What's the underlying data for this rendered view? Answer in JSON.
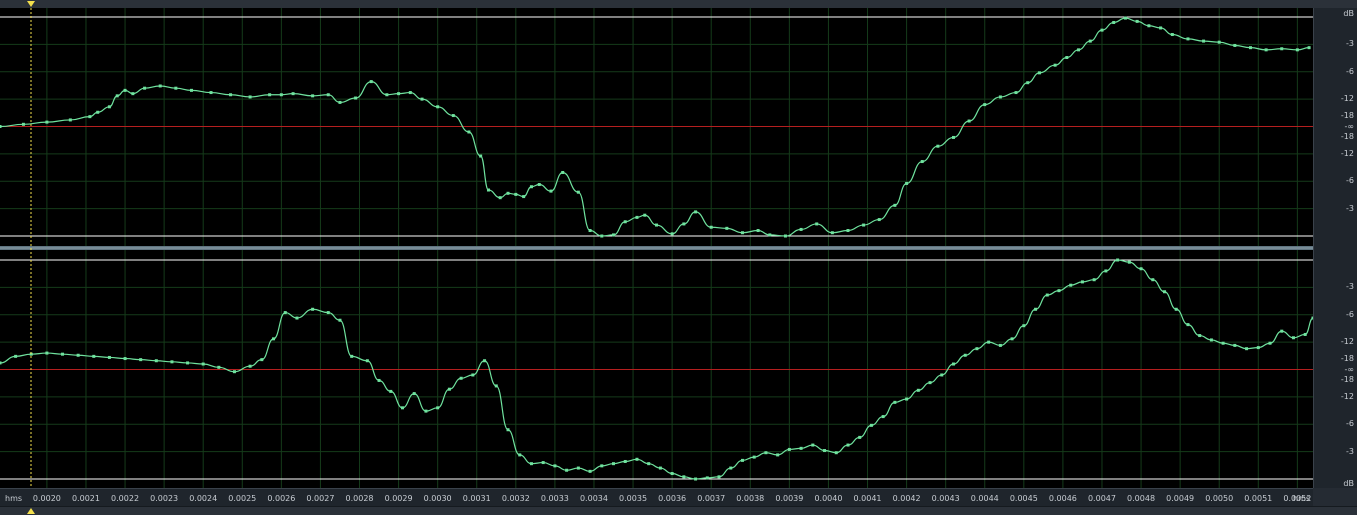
{
  "scale": {
    "unit_label": "dB",
    "channel1_labels": [
      "-3",
      "-6",
      "-12",
      "-18",
      "-∞",
      "-18",
      "-12",
      "-6",
      "-3"
    ],
    "channel2_labels": [
      "-3",
      "-6",
      "-12",
      "-18",
      "-∞",
      "-18",
      "-12",
      "-6",
      "-3"
    ]
  },
  "ruler": {
    "unit": "hms",
    "ticks": [
      "0.0020",
      "0.0021",
      "0.0022",
      "0.0023",
      "0.0024",
      "0.0025",
      "0.0026",
      "0.0027",
      "0.0028",
      "0.0029",
      "0.0030",
      "0.0031",
      "0.0032",
      "0.0033",
      "0.0034",
      "0.0035",
      "0.0036",
      "0.0037",
      "0.0038",
      "0.0039",
      "0.0040",
      "0.0041",
      "0.0042",
      "0.0043",
      "0.0044",
      "0.0045",
      "0.0046",
      "0.0047",
      "0.0048",
      "0.0049",
      "0.0050",
      "0.0051",
      "0.0052"
    ]
  },
  "colors": {
    "background": "#000000",
    "grid": "#153b1a",
    "waveform": "#6fe29e",
    "centerline": "#b51f1f",
    "boundary": "#ffffff",
    "cursor": "#f4e04d",
    "separator": "#607581"
  },
  "chart_data": [
    {
      "type": "line",
      "x": [
        0.00188,
        0.00194,
        0.002,
        0.00206,
        0.00211,
        0.00213,
        0.00216,
        0.00218,
        0.0022,
        0.00222,
        0.00225,
        0.00229,
        0.00233,
        0.00237,
        0.00242,
        0.00247,
        0.00252,
        0.00257,
        0.0026,
        0.00263,
        0.00268,
        0.00272,
        0.00275,
        0.00279,
        0.00283,
        0.00287,
        0.0029,
        0.00293,
        0.00296,
        0.003,
        0.00304,
        0.00308,
        0.00311,
        0.00313,
        0.00316,
        0.00318,
        0.0032,
        0.00322,
        0.00324,
        0.00326,
        0.00329,
        0.00332,
        0.00336,
        0.00339,
        0.00342,
        0.00345,
        0.00348,
        0.00351,
        0.00353,
        0.00356,
        0.0036,
        0.00363,
        0.00366,
        0.0037,
        0.00374,
        0.00378,
        0.00382,
        0.00385,
        0.00389,
        0.00393,
        0.00397,
        0.00401,
        0.00405,
        0.00409,
        0.00413,
        0.00417,
        0.0042,
        0.00424,
        0.00428,
        0.00432,
        0.00436,
        0.0044,
        0.00444,
        0.00448,
        0.00451,
        0.00454,
        0.00458,
        0.00461,
        0.00464,
        0.00467,
        0.0047,
        0.00473,
        0.00476,
        0.00479,
        0.00482,
        0.00485,
        0.00488,
        0.00492,
        0.00496,
        0.005,
        0.00504,
        0.00508,
        0.00512,
        0.00516,
        0.0052,
        0.00523
      ],
      "y": [
        0.0,
        0.02,
        0.04,
        0.06,
        0.09,
        0.13,
        0.18,
        0.28,
        0.33,
        0.3,
        0.35,
        0.37,
        0.35,
        0.33,
        0.31,
        0.29,
        0.27,
        0.29,
        0.29,
        0.3,
        0.28,
        0.29,
        0.22,
        0.26,
        0.41,
        0.29,
        0.3,
        0.31,
        0.25,
        0.18,
        0.1,
        -0.05,
        -0.27,
        -0.58,
        -0.65,
        -0.61,
        -0.62,
        -0.64,
        -0.55,
        -0.53,
        -0.59,
        -0.42,
        -0.6,
        -0.95,
        -1.0,
        -0.99,
        -0.87,
        -0.83,
        -0.81,
        -0.9,
        -0.98,
        -0.89,
        -0.78,
        -0.92,
        -0.93,
        -0.97,
        -0.95,
        -0.99,
        -1.0,
        -0.94,
        -0.89,
        -0.97,
        -0.95,
        -0.9,
        -0.85,
        -0.72,
        -0.52,
        -0.32,
        -0.18,
        -0.1,
        0.05,
        0.2,
        0.27,
        0.31,
        0.4,
        0.49,
        0.56,
        0.63,
        0.7,
        0.78,
        0.88,
        0.95,
        0.99,
        0.96,
        0.92,
        0.9,
        0.84,
        0.8,
        0.78,
        0.77,
        0.74,
        0.72,
        0.7,
        0.71,
        0.7,
        0.72
      ],
      "ylim": [
        -1,
        1
      ]
    },
    {
      "type": "line",
      "x": [
        0.00188,
        0.00192,
        0.00196,
        0.002,
        0.00204,
        0.00208,
        0.00212,
        0.00216,
        0.0022,
        0.00224,
        0.00228,
        0.00232,
        0.00236,
        0.0024,
        0.00244,
        0.00248,
        0.00252,
        0.00255,
        0.00258,
        0.00261,
        0.00264,
        0.00268,
        0.00272,
        0.00275,
        0.00278,
        0.00282,
        0.00285,
        0.00288,
        0.00291,
        0.00294,
        0.00297,
        0.003,
        0.00303,
        0.00306,
        0.00309,
        0.00312,
        0.00315,
        0.00318,
        0.00321,
        0.00324,
        0.00327,
        0.0033,
        0.00333,
        0.00336,
        0.00339,
        0.00342,
        0.00345,
        0.00348,
        0.00351,
        0.00354,
        0.00357,
        0.0036,
        0.00363,
        0.00366,
        0.00369,
        0.00372,
        0.00375,
        0.00378,
        0.00381,
        0.00384,
        0.00387,
        0.0039,
        0.00393,
        0.00396,
        0.00399,
        0.00402,
        0.00405,
        0.00408,
        0.00411,
        0.00414,
        0.00417,
        0.0042,
        0.00423,
        0.00426,
        0.00429,
        0.00432,
        0.00435,
        0.00438,
        0.00441,
        0.00444,
        0.00447,
        0.0045,
        0.00453,
        0.00456,
        0.00459,
        0.00462,
        0.00465,
        0.00468,
        0.00471,
        0.00474,
        0.00477,
        0.0048,
        0.00483,
        0.00486,
        0.00489,
        0.00492,
        0.00495,
        0.00498,
        0.00501,
        0.00504,
        0.00507,
        0.0051,
        0.00513,
        0.00516,
        0.00519,
        0.00522,
        0.00524
      ],
      "y": [
        0.06,
        0.12,
        0.14,
        0.15,
        0.14,
        0.13,
        0.12,
        0.11,
        0.1,
        0.09,
        0.08,
        0.07,
        0.06,
        0.05,
        0.02,
        -0.02,
        0.03,
        0.09,
        0.28,
        0.52,
        0.47,
        0.55,
        0.52,
        0.45,
        0.12,
        0.08,
        -0.1,
        -0.2,
        -0.35,
        -0.22,
        -0.38,
        -0.35,
        -0.18,
        -0.08,
        -0.05,
        0.08,
        -0.15,
        -0.55,
        -0.78,
        -0.86,
        -0.85,
        -0.88,
        -0.92,
        -0.9,
        -0.93,
        -0.88,
        -0.86,
        -0.84,
        -0.82,
        -0.86,
        -0.9,
        -0.95,
        -0.98,
        -1.0,
        -0.99,
        -0.98,
        -0.9,
        -0.83,
        -0.8,
        -0.76,
        -0.78,
        -0.73,
        -0.72,
        -0.69,
        -0.74,
        -0.76,
        -0.69,
        -0.62,
        -0.51,
        -0.43,
        -0.3,
        -0.27,
        -0.19,
        -0.12,
        -0.05,
        0.05,
        0.13,
        0.19,
        0.25,
        0.22,
        0.28,
        0.4,
        0.55,
        0.68,
        0.72,
        0.77,
        0.8,
        0.82,
        0.9,
        1.0,
        0.98,
        0.92,
        0.82,
        0.71,
        0.55,
        0.41,
        0.31,
        0.27,
        0.24,
        0.22,
        0.19,
        0.2,
        0.24,
        0.35,
        0.29,
        0.32,
        0.47,
        0.68,
        0.78
      ],
      "ylim": [
        -1,
        1
      ]
    }
  ]
}
